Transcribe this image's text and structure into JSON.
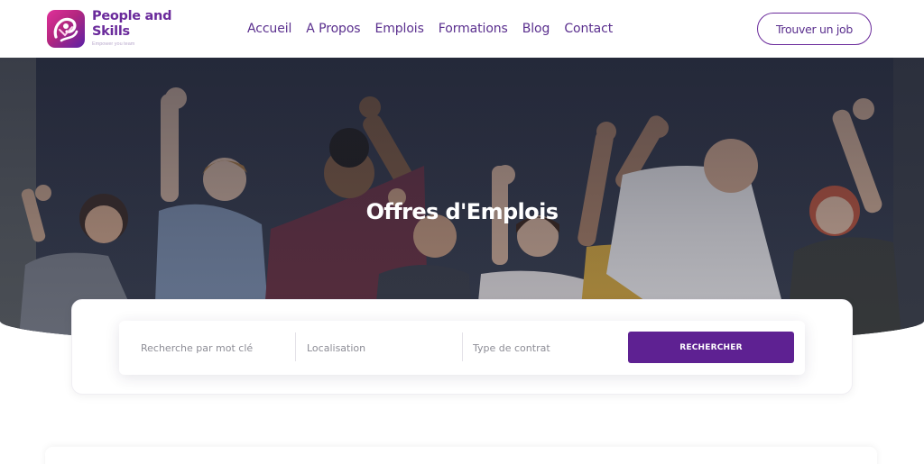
{
  "brand": {
    "name": "People and Skills",
    "tagline": "Empower you team"
  },
  "nav": {
    "items": [
      {
        "label": "Accueil"
      },
      {
        "label": "A Propos"
      },
      {
        "label": "Emplois"
      },
      {
        "label": "Formations"
      },
      {
        "label": "Blog"
      },
      {
        "label": "Contact"
      }
    ],
    "cta_label": "Trouver un job"
  },
  "hero": {
    "title": "Offres d'Emplois"
  },
  "search": {
    "keyword_placeholder": "Recherche par mot clé",
    "location_placeholder": "Localisation",
    "contract_placeholder": "Type de contrat",
    "button_label": "RECHERCHER"
  },
  "colors": {
    "brand_purple": "#5e2192",
    "nav_text": "#5a2f8e",
    "logo_gradient_start": "#e0309a",
    "logo_gradient_end": "#5b21a6"
  }
}
